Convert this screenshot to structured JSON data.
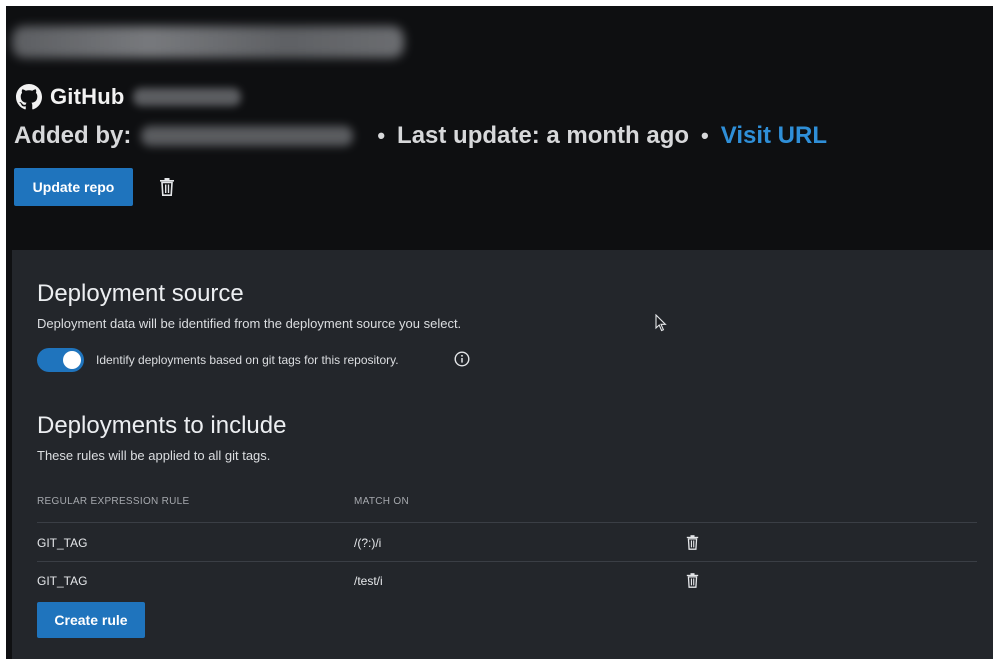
{
  "header": {
    "provider": "GitHub",
    "added_by_label": "Added by:",
    "last_update_label": "Last update: a month ago",
    "separator": "•",
    "visit_link": "Visit URL",
    "update_button": "Update repo"
  },
  "deployment_source": {
    "title": "Deployment source",
    "description": "Deployment data will be identified from the deployment source you select.",
    "toggle_label": "Identify deployments based on git tags for this repository.",
    "toggle_on": true
  },
  "deployments_include": {
    "title": "Deployments to include",
    "description": "These rules will be applied to all git tags.",
    "columns": [
      "REGULAR EXPRESSION RULE",
      "MATCH ON"
    ],
    "rows": [
      {
        "rule": "GIT_TAG",
        "match": "/(?:)/i"
      },
      {
        "rule": "GIT_TAG",
        "match": "/test/i"
      }
    ],
    "create_button": "Create rule"
  },
  "colors": {
    "accent": "#1f74bd",
    "link": "#2f8fd8",
    "header_bg": "#0e0f11",
    "panel_bg": "#23262b"
  },
  "icons": [
    "github-icon",
    "trash-icon",
    "info-icon",
    "mouse-cursor-icon"
  ]
}
